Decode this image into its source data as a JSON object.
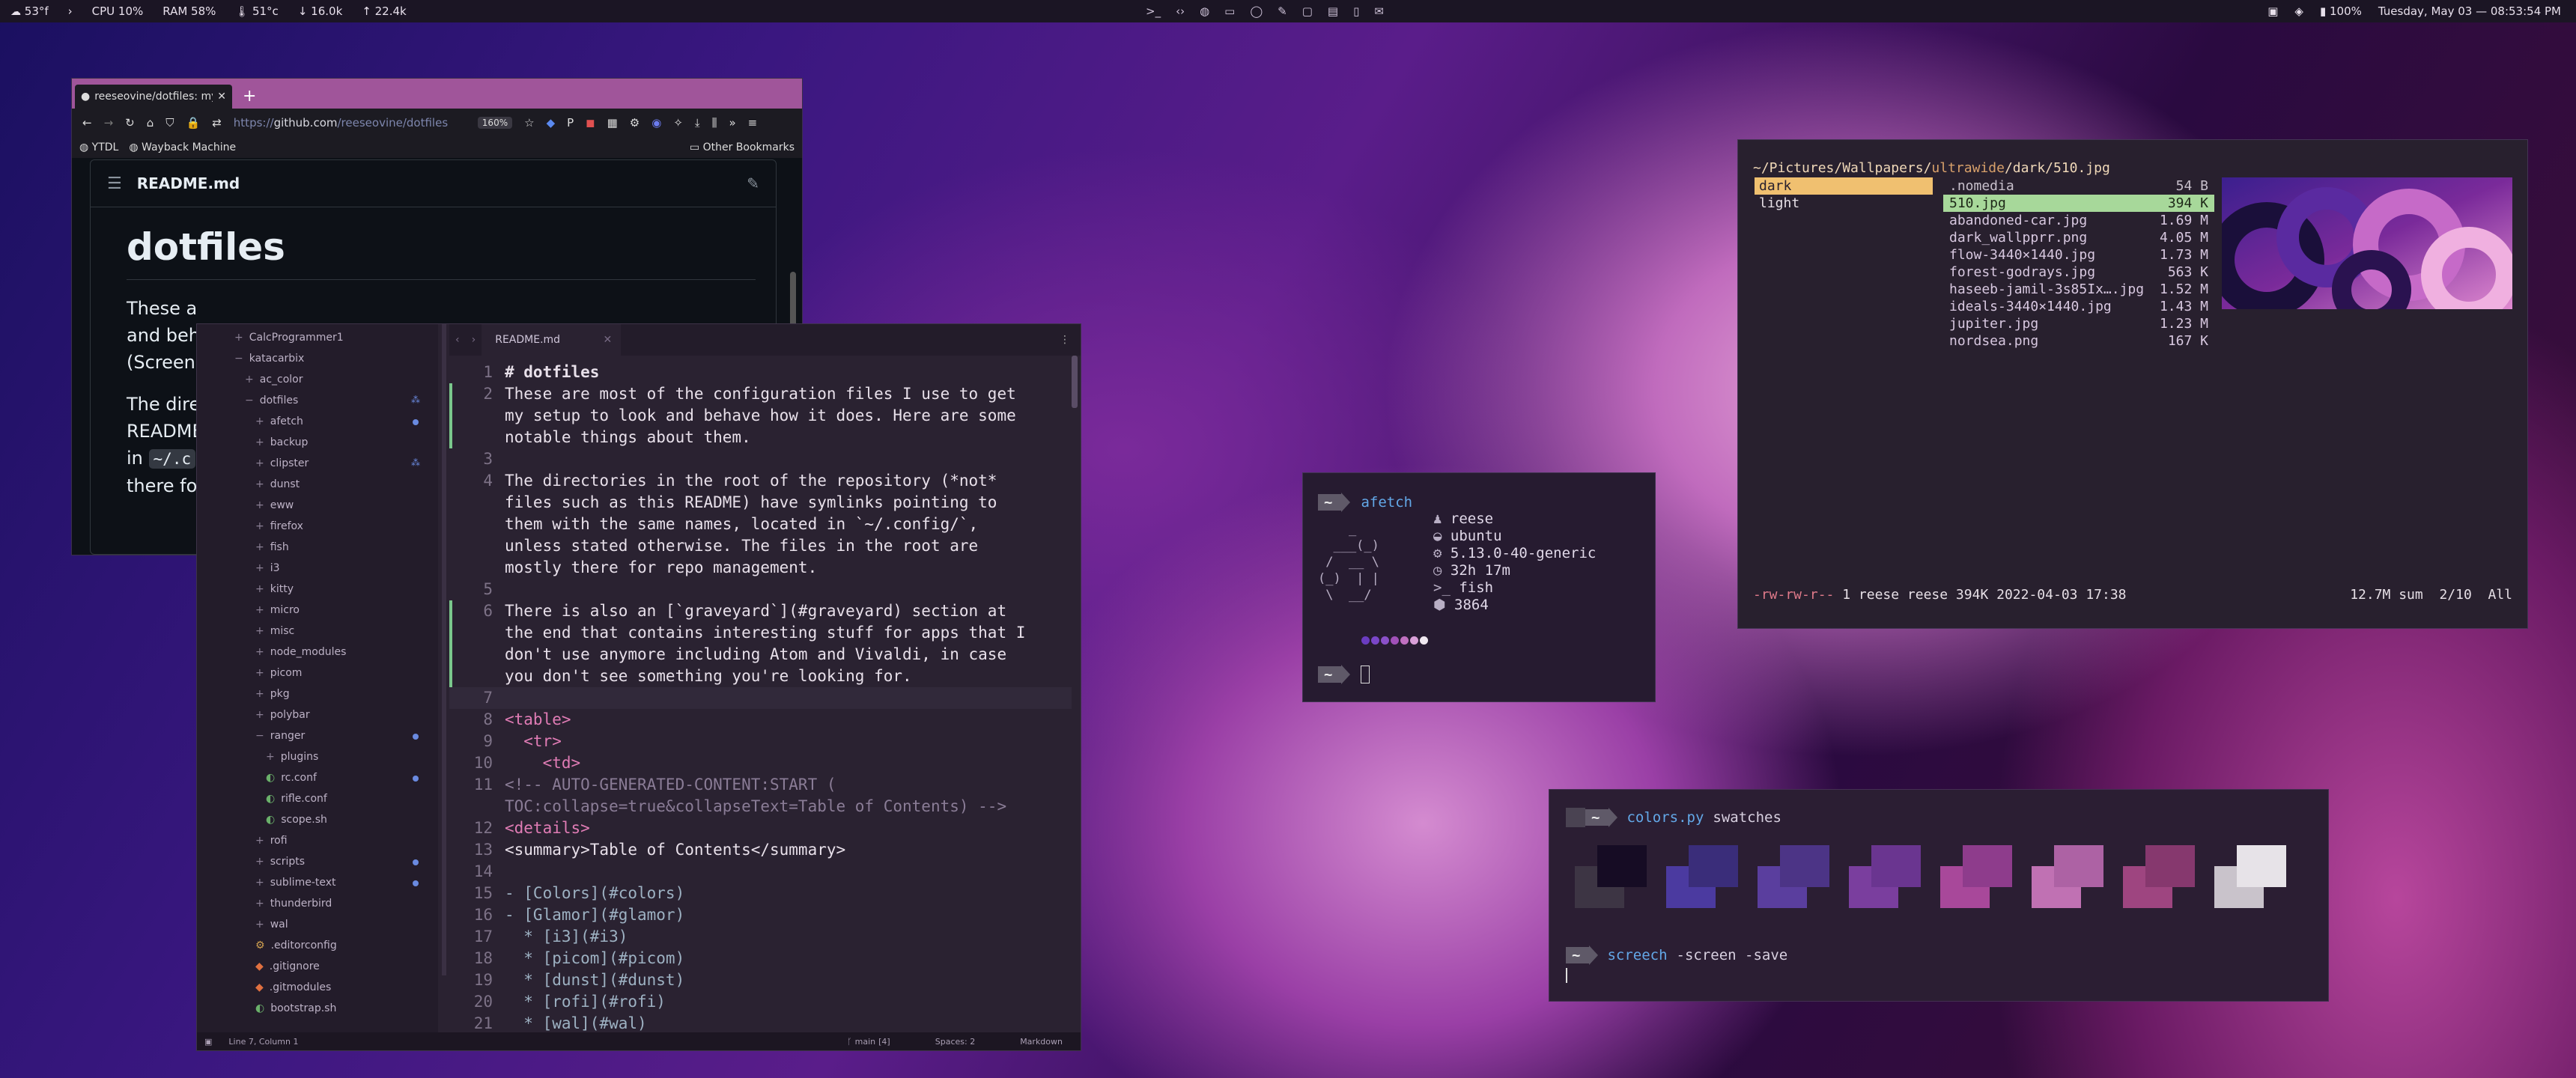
{
  "topbar": {
    "weather": "53°f",
    "cpu": "CPU 10%",
    "ram": "RAM 58%",
    "temp": "51°c",
    "down": "16.0k",
    "up": "22.4k",
    "battery": "100%",
    "datetime": "Tuesday, May 03 — 08:53:54 PM"
  },
  "browser": {
    "tab_title": "reeseovine/dotfiles: my",
    "new_tab": "+",
    "url_prefix": "https://",
    "url_host": "github.com",
    "url_path": "/reeseovine/dotfiles",
    "zoom": "160%",
    "bookmarks": [
      "YTDL",
      "Wayback Machine"
    ],
    "other_bookmarks": "Other Bookmarks",
    "readme_file": "README.md",
    "readme_title": "dotfiles",
    "p1_visible": "These a",
    "p1_line2": "and beh",
    "p1_line3": "(Screen",
    "p2_line1": "The dire",
    "p2_line2": "README",
    "p2_in": "in",
    "p2_code": "~/.c",
    "p2_line4": "there fo"
  },
  "editor": {
    "tree": [
      {
        "label": "CalcProgrammer1",
        "indent": 0,
        "icon": "+"
      },
      {
        "label": "katacarbix",
        "indent": 0,
        "icon": "−"
      },
      {
        "label": "ac_color",
        "indent": 1,
        "icon": "+"
      },
      {
        "label": "dotfiles",
        "indent": 1,
        "icon": "−"
      },
      {
        "label": "afetch",
        "indent": 2,
        "icon": "+"
      },
      {
        "label": "backup",
        "indent": 2,
        "icon": "+"
      },
      {
        "label": "clipster",
        "indent": 2,
        "icon": "+"
      },
      {
        "label": "dunst",
        "indent": 2,
        "icon": "+"
      },
      {
        "label": "eww",
        "indent": 2,
        "icon": "+"
      },
      {
        "label": "firefox",
        "indent": 2,
        "icon": "+"
      },
      {
        "label": "fish",
        "indent": 2,
        "icon": "+"
      },
      {
        "label": "i3",
        "indent": 2,
        "icon": "+"
      },
      {
        "label": "kitty",
        "indent": 2,
        "icon": "+"
      },
      {
        "label": "micro",
        "indent": 2,
        "icon": "+"
      },
      {
        "label": "misc",
        "indent": 2,
        "icon": "+"
      },
      {
        "label": "node_modules",
        "indent": 2,
        "icon": "+"
      },
      {
        "label": "picom",
        "indent": 2,
        "icon": "+"
      },
      {
        "label": "pkg",
        "indent": 2,
        "icon": "+"
      },
      {
        "label": "polybar",
        "indent": 2,
        "icon": "+"
      },
      {
        "label": "ranger",
        "indent": 2,
        "icon": "−"
      },
      {
        "label": "plugins",
        "indent": 3,
        "icon": "+"
      },
      {
        "label": "rc.conf",
        "indent": 3,
        "icon": "file"
      },
      {
        "label": "rifle.conf",
        "indent": 3,
        "icon": "file"
      },
      {
        "label": "scope.sh",
        "indent": 3,
        "icon": "file"
      },
      {
        "label": "rofi",
        "indent": 2,
        "icon": "+"
      },
      {
        "label": "scripts",
        "indent": 2,
        "icon": "+"
      },
      {
        "label": "sublime-text",
        "indent": 2,
        "icon": "+"
      },
      {
        "label": "thunderbird",
        "indent": 2,
        "icon": "+"
      },
      {
        "label": "wal",
        "indent": 2,
        "icon": "+"
      },
      {
        "label": ".editorconfig",
        "indent": 2,
        "icon": "cfg"
      },
      {
        "label": ".gitignore",
        "indent": 2,
        "icon": "git"
      },
      {
        "label": ".gitmodules",
        "indent": 2,
        "icon": "git"
      },
      {
        "label": "bootstrap.sh",
        "indent": 2,
        "icon": "file"
      }
    ],
    "tab": "README.md",
    "lines": [
      {
        "n": "1",
        "t": "# dotfiles"
      },
      {
        "n": "2",
        "t": "These are most of the configuration files I use to get"
      },
      {
        "n": "",
        "t": "my setup to look and behave how it does. Here are some"
      },
      {
        "n": "",
        "t": "notable things about them."
      },
      {
        "n": "3",
        "t": ""
      },
      {
        "n": "4",
        "t": "The directories in the root of the repository (*not*"
      },
      {
        "n": "",
        "t": "files such as this README) have symlinks pointing to"
      },
      {
        "n": "",
        "t": "them with the same names, located in `~/.config/`,"
      },
      {
        "n": "",
        "t": "unless stated otherwise. The files in the root are"
      },
      {
        "n": "",
        "t": "mostly there for repo management."
      },
      {
        "n": "5",
        "t": ""
      },
      {
        "n": "6",
        "t": "There is also an [`graveyard`](#graveyard) section at"
      },
      {
        "n": "",
        "t": "the end that contains interesting stuff for apps that I"
      },
      {
        "n": "",
        "t": "don't use anymore including Atom and Vivaldi, in case"
      },
      {
        "n": "",
        "t": "you don't see something you're looking for."
      },
      {
        "n": "7",
        "t": ""
      },
      {
        "n": "8",
        "t": "<table>"
      },
      {
        "n": "9",
        "t": "  <tr>"
      },
      {
        "n": "10",
        "t": "    <td>"
      },
      {
        "n": "11",
        "t": "<!-- AUTO-GENERATED-CONTENT:START ("
      },
      {
        "n": "",
        "t": "TOC:collapse=true&collapseText=Table of Contents) -->"
      },
      {
        "n": "12",
        "t": "<details>"
      },
      {
        "n": "13",
        "t": "<summary>Table of Contents</summary>"
      },
      {
        "n": "14",
        "t": ""
      },
      {
        "n": "15",
        "t": "- [Colors](#colors)"
      },
      {
        "n": "16",
        "t": "- [Glamor](#glamor)"
      },
      {
        "n": "17",
        "t": "  * [i3](#i3)"
      },
      {
        "n": "18",
        "t": "  * [picom](#picom)"
      },
      {
        "n": "19",
        "t": "  * [dunst](#dunst)"
      },
      {
        "n": "20",
        "t": "  * [rofi](#rofi)"
      },
      {
        "n": "21",
        "t": "  * [wal](#wal)"
      }
    ],
    "status_position": "Line 7, Column 1",
    "status_branch": "main",
    "status_spaces": "Spaces: 2",
    "status_syntax": "Markdown"
  },
  "afetch": {
    "prompt": "~",
    "command": "afetch",
    "user": "reese",
    "os": "ubuntu",
    "kernel": "5.13.0-40-generic",
    "uptime": "32h 17m",
    "shell": "fish",
    "packages": "3864"
  },
  "ranger": {
    "path_prefix": "~/Pictures/Wallpapers/",
    "path_mid": "ultrawide",
    "path_suffix": "/dark/510.jpg",
    "left": [
      "dark",
      "light"
    ],
    "files": [
      {
        "name": ".nomedia",
        "size": "54 B"
      },
      {
        "name": "510.jpg",
        "size": "394 K"
      },
      {
        "name": "abandoned-car.jpg",
        "size": "1.69 M"
      },
      {
        "name": "dark_wallpprr.png",
        "size": "4.05 M"
      },
      {
        "name": "flow-3440×1440.jpg",
        "size": "1.73 M"
      },
      {
        "name": "forest-godrays.jpg",
        "size": "563 K"
      },
      {
        "name": "haseeb-jamil-3s85Ix….jpg",
        "size": "1.52 M"
      },
      {
        "name": "ideals-3440×1440.jpg",
        "size": "1.43 M"
      },
      {
        "name": "jupiter.jpg",
        "size": "1.23 M"
      },
      {
        "name": "nordsea.png",
        "size": "167 K"
      }
    ],
    "status_perm": "-rw-rw-r--",
    "status_info": "1 reese reese 394K 2022-04-03 17:38",
    "status_sum": "12.7M sum",
    "status_pos": "2/10",
    "status_all": "All"
  },
  "colors_term": {
    "prompt": "~",
    "command": "colors.py",
    "arg": "swatches",
    "command2": "screech",
    "args2": "-screen -save",
    "swatches": [
      "#3d3544",
      "#4b3aa0",
      "#5a3e9e",
      "#7a3e9e",
      "#a8489a",
      "#c071b3",
      "#9e4580",
      "#c9c3cb"
    ],
    "swatches_dark": [
      "#160c24",
      "#3a2d7a",
      "#4c3486",
      "#6a3590",
      "#8e3c8c",
      "#ad62a4",
      "#86386e",
      "#e7e3e8"
    ]
  }
}
